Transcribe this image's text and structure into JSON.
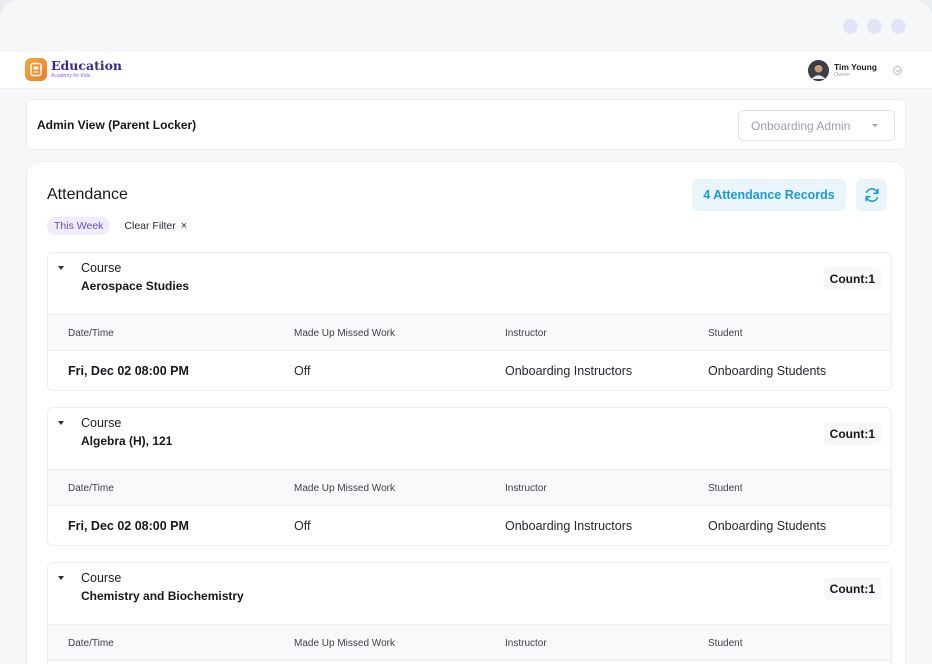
{
  "brand": {
    "title": "Education",
    "subtitle": "Academy for Kids"
  },
  "user": {
    "name": "Tim Young",
    "role": "Owner"
  },
  "admin": {
    "title": "Admin View (Parent Locker)",
    "select_value": "Onboarding Admin"
  },
  "attendance": {
    "title": "Attendance",
    "records_label": "4 Attendance Records",
    "filter_chip": "This Week",
    "clear_filter": "Clear Filter",
    "clear_icon": "×"
  },
  "columns": [
    "Date/Time",
    "Made Up Missed Work",
    "Instructor",
    "Student"
  ],
  "groups": [
    {
      "label": "Course",
      "name": "Aerospace Studies",
      "count": "Count:1",
      "rows": [
        {
          "datetime": "Fri, Dec 02 08:00 PM",
          "made_up": "Off",
          "instructor": "Onboarding Instructors",
          "student": "Onboarding Students"
        }
      ]
    },
    {
      "label": "Course",
      "name": "Algebra (H), 121",
      "count": "Count:1",
      "rows": [
        {
          "datetime": "Fri, Dec 02 08:00 PM",
          "made_up": "Off",
          "instructor": "Onboarding Instructors",
          "student": "Onboarding Students"
        }
      ]
    },
    {
      "label": "Course",
      "name": "Chemistry and Biochemistry",
      "count": "Count:1",
      "rows": []
    }
  ],
  "icons": {
    "refresh": "refresh-icon",
    "caret": "caret-down-icon",
    "collapse": "collapse-toggle-icon"
  },
  "colors": {
    "accent": "#1b9ad6",
    "accent_bg": "#eaf5fb",
    "chip_text": "#6a4cc4",
    "chip_bg": "#f1ecfc",
    "brand": "#3c2a8a",
    "logo": "#f29a36"
  }
}
